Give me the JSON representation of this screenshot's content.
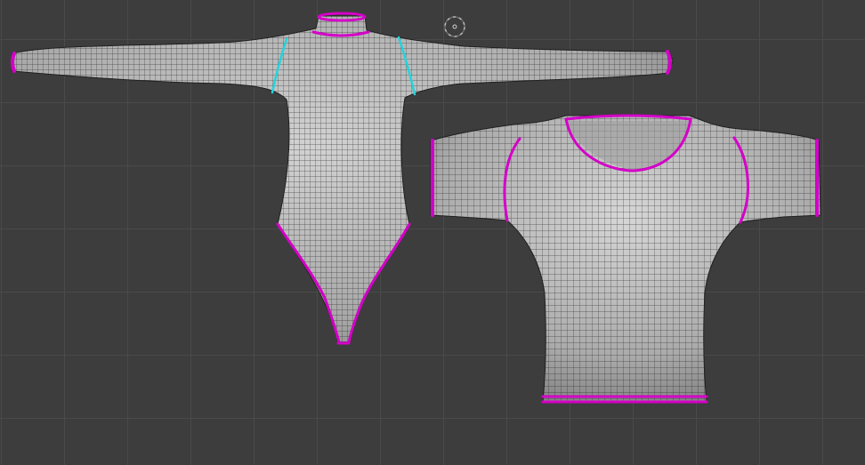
{
  "viewport": {
    "background": "#3d3d3d",
    "grid_color": "#4a4a4a",
    "mesh_fill": "#b8b8b8",
    "wire_color": "#1e1e1e",
    "seam_selected_color": "#d400c8",
    "seam_active_color": "#23d3dd"
  },
  "objects": [
    {
      "name": "long-sleeve-bodysuit",
      "type": "mesh"
    },
    {
      "name": "short-sleeve-tshirt",
      "type": "mesh"
    }
  ],
  "cursor_3d": {
    "icon": "3d-cursor-icon"
  }
}
